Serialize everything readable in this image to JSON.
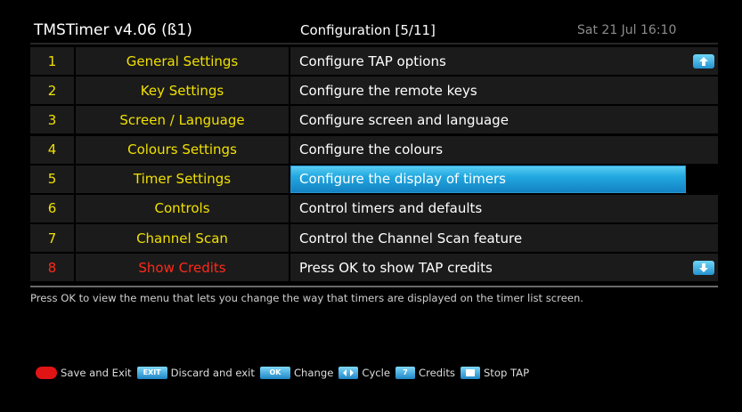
{
  "header": {
    "app_title": "TMSTimer v4.06 (ß1)",
    "page_title": "Configuration [5/11]",
    "datetime": "Sat 21 Jul 16:10"
  },
  "menu": {
    "rows": [
      {
        "num": "1",
        "name": "General Settings",
        "desc": "Configure TAP options"
      },
      {
        "num": "2",
        "name": "Key Settings",
        "desc": "Configure the remote keys"
      },
      {
        "num": "3",
        "name": "Screen / Language",
        "desc": "Configure screen and language"
      },
      {
        "num": "4",
        "name": "Colours Settings",
        "desc": "Configure the colours"
      },
      {
        "num": "5",
        "name": "Timer Settings",
        "desc": "Configure the display of timers"
      },
      {
        "num": "6",
        "name": "Controls",
        "desc": "Control timers and defaults"
      },
      {
        "num": "7",
        "name": "Channel Scan",
        "desc": "Control the Channel Scan feature"
      },
      {
        "num": "8",
        "name": "Show Credits",
        "desc": "Press OK to show TAP credits"
      }
    ],
    "selected_index": 4
  },
  "help_text": "Press OK to view the menu that lets you change the way that timers are displayed on the timer list screen.",
  "legend": {
    "save_exit": "Save and Exit",
    "exit_key": "EXIT",
    "discard_exit": "Discard and exit",
    "ok_key": "OK",
    "change": "Change",
    "cycle": "Cycle",
    "credits_key": "7",
    "credits": "Credits",
    "stop_tap": "Stop TAP"
  },
  "icons": {
    "scroll_up": "scroll-up-arrow-icon",
    "scroll_down": "scroll-down-arrow-icon",
    "red_key": "red-button-icon",
    "cycle_key": "left-right-arrows-icon",
    "stop_key": "square-stop-icon"
  },
  "colors": {
    "label_yellow": "#f0e000",
    "label_red": "#ff2a1a",
    "highlight_blue": "#22a8e0",
    "red_key": "#e01414"
  }
}
